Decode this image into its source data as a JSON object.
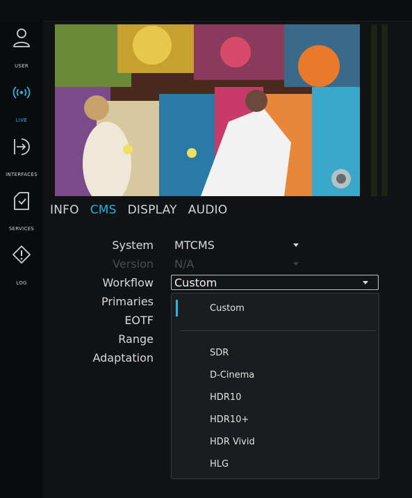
{
  "sidebar": {
    "items": [
      {
        "label": "USER",
        "icon": "user-icon"
      },
      {
        "label": "LIVE",
        "icon": "broadcast-icon",
        "active": true
      },
      {
        "label": "INTERFACES",
        "icon": "interfaces-icon"
      },
      {
        "label": "SERVICES",
        "icon": "services-icon"
      },
      {
        "label": "LOG",
        "icon": "warning-icon"
      }
    ]
  },
  "tabs": [
    "INFO",
    "CMS",
    "DISPLAY",
    "AUDIO"
  ],
  "active_tab": "CMS",
  "form": {
    "system_label": "System",
    "system_value": "MTCMS",
    "version_label": "Version",
    "version_value": "N/A",
    "workflow_label": "Workflow",
    "workflow_value": "Custom",
    "primaries_label": "Primaries",
    "eotf_label": "EOTF",
    "range_label": "Range",
    "adaptation_label": "Adaptation"
  },
  "dropdown": {
    "options": [
      "Custom",
      "SDR",
      "D-Cinema",
      "HDR10",
      "HDR10+",
      "HDR Vivid",
      "HLG"
    ],
    "selected": "Custom"
  },
  "colors": {
    "accent": "#1ab4ea",
    "background": "#111213"
  }
}
